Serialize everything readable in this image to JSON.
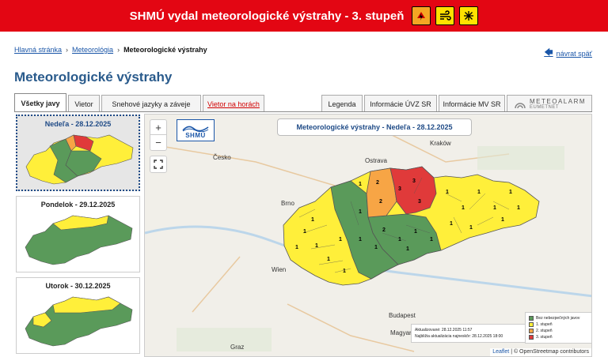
{
  "banner": {
    "text": "SHMÚ vydal meteorologické výstrahy - 3. stupeň",
    "icons": [
      "thunderstorm-icon",
      "wind-icon",
      "snow-icon"
    ]
  },
  "breadcrumb": {
    "items": [
      "Hlavná stránka",
      "Meteorológia",
      "Meteorologické výstrahy"
    ],
    "back_label": "návrat späť"
  },
  "page_title": "Meteorologické výstrahy",
  "tabs": {
    "left": [
      "Všetky javy",
      "Vietor",
      "Snehové jazyky a záveje",
      "Vietor na horách"
    ],
    "right": [
      "Legenda",
      "Informácie ÚVZ SR",
      "Informácie MV SR"
    ],
    "meteoalarm_label": "METEOALARM",
    "meteoalarm_sub": "EUMETNET"
  },
  "days": [
    {
      "label": "Nedeľa - 28.12.2025",
      "selected": true
    },
    {
      "label": "Pondelok - 29.12.2025",
      "selected": false
    },
    {
      "label": "Utorok - 30.12.2025",
      "selected": false
    }
  ],
  "map": {
    "title": "Meteorologické výstrahy - Nedeľa - 28.12.2025",
    "logo_text": "SHMÚ",
    "zoom_in": "+",
    "zoom_out": "−",
    "cities": [
      "Česko",
      "Ostrava",
      "Kraków",
      "Brno",
      "Wien",
      "Budapest",
      "Magyar",
      "Graz"
    ],
    "update_line1": "Aktualizované: 28.12.2025 11:57",
    "update_line2": "Najbližia aktualizácia najneskôr: 28.12.2025 18:00",
    "attribution_leaflet": "Leaflet",
    "attribution_osm": "| © OpenStreetmap contributors"
  },
  "legend": {
    "items": [
      {
        "label": "Bez nebezpečných javov",
        "color": "#5a9a5a"
      },
      {
        "label": "1. stupeň",
        "color": "#ffef3a"
      },
      {
        "label": "2. stupeň",
        "color": "#f7a545"
      },
      {
        "label": "3. stupeň",
        "color": "#e03a3a"
      }
    ]
  },
  "colors": {
    "banner": "#e30613",
    "title": "#2a5b8c",
    "green": "#5a9a5a",
    "yellow": "#ffef3a",
    "orange": "#f7a545",
    "red": "#e03a3a"
  }
}
